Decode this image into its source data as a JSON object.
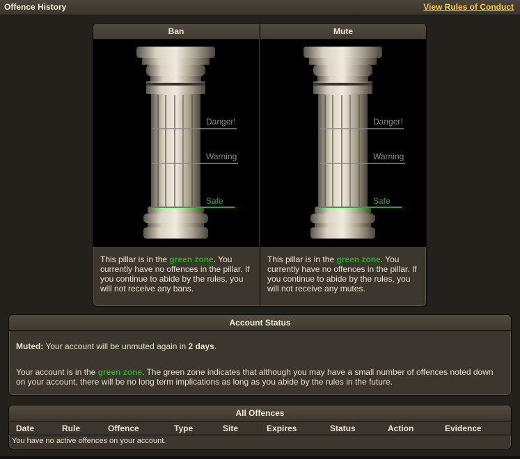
{
  "header": {
    "title": "Offence History",
    "rules_link": "View Rules of Conduct"
  },
  "pillars": [
    {
      "name": "Ban",
      "zones": {
        "danger": "Danger!",
        "warning": "Warning",
        "safe": "Safe"
      },
      "current_zone": "safe",
      "text_before": "This pillar is in the ",
      "zone_text": "green zone",
      "text_after": ". You currently have no offences in the pillar. If you continue to abide by the rules, you will not receive any bans."
    },
    {
      "name": "Mute",
      "zones": {
        "danger": "Danger!",
        "warning": "Warning",
        "safe": "Safe"
      },
      "current_zone": "safe",
      "text_before": "This pillar is in the ",
      "zone_text": "green zone",
      "text_after": ". You currently have no offences in the pillar. If you continue to abide by the rules, you will not receive any mutes."
    }
  ],
  "account_status": {
    "title": "Account Status",
    "muted_label": "Muted:",
    "muted_text": " Your account will be unmuted again in ",
    "muted_duration": "2 days",
    "muted_end": ".",
    "zone_before": "Your account is in the ",
    "zone_text": "green zone",
    "zone_after": ". The green zone indicates that although you may have a small number of offences noted down on your account, there will be no long term implications as long as you abide by the rules in the future."
  },
  "offences": {
    "title": "All Offences",
    "columns": [
      "Date",
      "Rule",
      "Offence",
      "Type",
      "Site",
      "Expires",
      "Status",
      "Action",
      "Evidence"
    ],
    "empty_text": "You have no active offences on your account."
  },
  "colors": {
    "safe": "#20b020",
    "line_grey": "#8a8a8a",
    "link": "#ffcc2a"
  }
}
